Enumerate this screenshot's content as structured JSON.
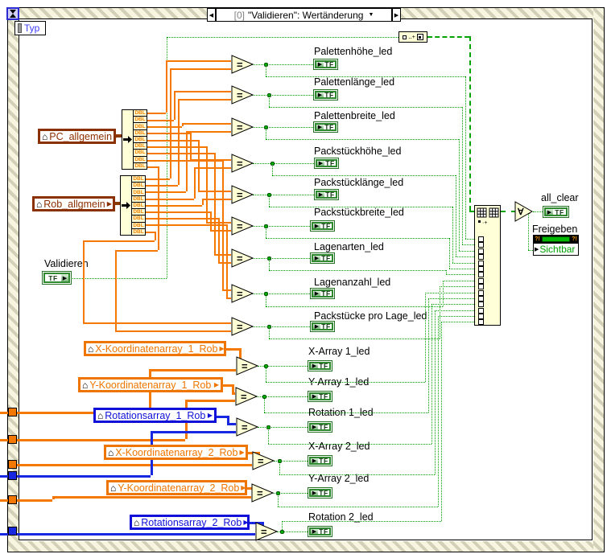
{
  "frame": {
    "selector_index": "[0]",
    "selector_title": "\"Validieren\": Wertänderung",
    "event_data_label": "Typ"
  },
  "icons": {
    "selector_left": "◀",
    "selector_right": "▶",
    "dropdown": "▼",
    "house": "⌂",
    "terminal_arrow": "▶",
    "and_array_glyph": "∀",
    "equal_glyph": "=",
    "build_array_glyph": "·+"
  },
  "tf": "TF",
  "unbundle": {
    "type": "DBL"
  },
  "validieren": {
    "label": "Validieren"
  },
  "controls": [
    {
      "label": "PC_allgemein"
    },
    {
      "label": "Rob_allgmein"
    },
    {
      "label": "X-Koordinatenarray_1_Rob"
    },
    {
      "label": "Y-Koordinatenarray_1_Rob"
    },
    {
      "label": "Rotationsarray_1_Rob"
    },
    {
      "label": "X-Koordinatenarray_2_Rob"
    },
    {
      "label": "Y-Koordinatenarray_2_Rob"
    },
    {
      "label": "Rotationsarray_2_Rob"
    }
  ],
  "leds": [
    {
      "label": "Palettenhöhe_led"
    },
    {
      "label": "Palettenlänge_led"
    },
    {
      "label": "Palettenbreite_led"
    },
    {
      "label": "Packstückhöhe_led"
    },
    {
      "label": "Packstücklänge_led"
    },
    {
      "label": "Packstückbreite_led"
    },
    {
      "label": "Lagenarten_led"
    },
    {
      "label": "Lagenanzahl_led"
    },
    {
      "label": "Packstücke pro Lage_led"
    },
    {
      "label": "X-Array 1_led"
    },
    {
      "label": "Y-Array 1_led"
    },
    {
      "label": "Rotation 1_led"
    },
    {
      "label": "X-Array 2_led"
    },
    {
      "label": "Y-Array 2_led"
    },
    {
      "label": "Rotation 2_led"
    }
  ],
  "outputs": {
    "all_clear": "all_clear",
    "freigeben": "Freigeben",
    "property": "Sichtbar",
    "property_glyph": "?!"
  },
  "colors": {
    "boolean_green": "#00A300",
    "dbl_orange": "#F57900",
    "i32_blue": "#1828E0",
    "cluster_brown": "#8B3A00"
  }
}
